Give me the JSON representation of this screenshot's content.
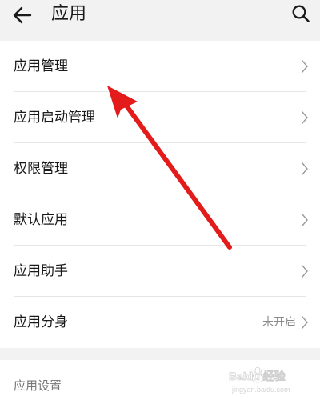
{
  "header": {
    "title": "应用",
    "back_icon": "arrow-left-icon",
    "search_icon": "search-icon"
  },
  "items": [
    {
      "label": "应用管理",
      "icon": "chevron-right-icon"
    },
    {
      "label": "应用启动管理",
      "icon": "chevron-right-icon"
    },
    {
      "label": "权限管理",
      "icon": "chevron-right-icon"
    },
    {
      "label": "默认应用",
      "icon": "chevron-right-icon"
    },
    {
      "label": "应用助手",
      "icon": "chevron-right-icon"
    },
    {
      "label": "应用分身",
      "status": "未开启",
      "icon": "chevron-right-icon"
    }
  ],
  "section": {
    "title": "应用设置"
  },
  "annotation": {
    "arrow_color": "#e31b1b"
  },
  "watermark": {
    "brand": "Baidu 经验",
    "url": "jingyan.baidu.com"
  }
}
